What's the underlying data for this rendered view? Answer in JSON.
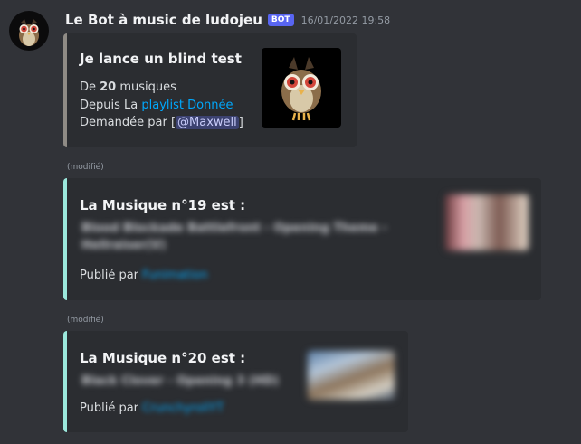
{
  "message": {
    "author": "Le Bot à music de ludojeu",
    "badge": "BOT",
    "timestamp": "16/01/2022 19:58"
  },
  "embed1": {
    "title": "Je lance un blind test",
    "line1_prefix": "De ",
    "line1_count": "20",
    "line1_suffix": " musiques",
    "line2_prefix": "Depuis La ",
    "line2_link": "playlist Donnée",
    "line3_prefix": "Demandée par [",
    "line3_mention": "@Maxwell",
    "line3_suffix": "]"
  },
  "embed2": {
    "edited_label": "(modifié)",
    "title": "La Musique n°19 est :",
    "song_line1": "Blood Blockade Battlefront - Opening Theme -",
    "song_line2": "Hellraiser(V)",
    "published_prefix": "Publié par",
    "publisher": "Funimation"
  },
  "embed3": {
    "edited_label": "(modifié)",
    "title": "La Musique n°20 est :",
    "song_line1": "Black Clover - Opening 3 (HD)",
    "published_prefix": "Publié par",
    "publisher": "CrunchyrollYT"
  },
  "colors": {
    "background": "#313338",
    "embed_background": "#2b2d31",
    "link": "#00a8fc",
    "bot_badge": "#5865f2",
    "embed1_border": "#8f8b85",
    "embed2_border": "#9be8dc"
  },
  "icons": {
    "avatar": "hoothoot-owl-avatar",
    "thumbnail1": "hoothoot-owl-thumbnail",
    "thumbnail2": "anime-thumbnail-blurred",
    "thumbnail3": "anime-thumbnail-blurred"
  }
}
